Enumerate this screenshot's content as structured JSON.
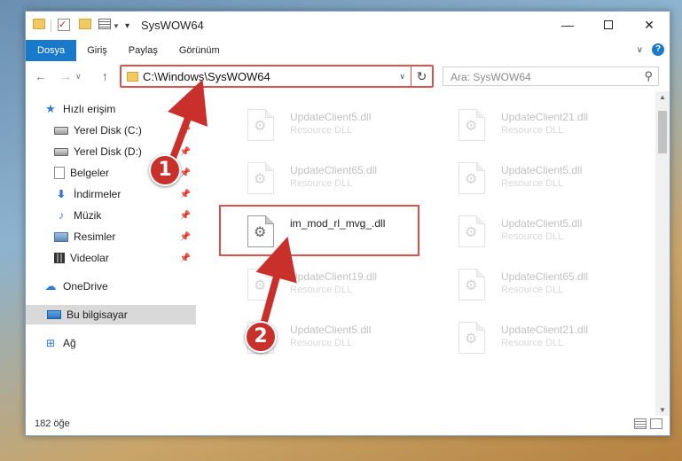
{
  "window": {
    "title": "SysWOW64"
  },
  "ribbon": {
    "tabs": [
      "Dosya",
      "Giriş",
      "Paylaş",
      "Görünüm"
    ],
    "help": "?"
  },
  "address": {
    "path": "C:\\Windows\\SysWOW64"
  },
  "search": {
    "placeholder": "Ara: SysWOW64"
  },
  "sidebar": {
    "items": [
      {
        "label": "Hızlı erişim",
        "icon": "star-icon"
      },
      {
        "label": "Yerel Disk (C:)",
        "icon": "drive-icon",
        "pinned": true
      },
      {
        "label": "Yerel Disk (D:)",
        "icon": "drive-icon",
        "pinned": true
      },
      {
        "label": "Belgeler",
        "icon": "documents-icon",
        "pinned": true
      },
      {
        "label": "İndirmeler",
        "icon": "download-icon",
        "pinned": true
      },
      {
        "label": "Müzik",
        "icon": "music-icon",
        "pinned": true
      },
      {
        "label": "Resimler",
        "icon": "pictures-icon",
        "pinned": true
      },
      {
        "label": "Videolar",
        "icon": "videos-icon",
        "pinned": true
      },
      {
        "label": "OneDrive",
        "icon": "cloud-icon"
      },
      {
        "label": "Bu bilgisayar",
        "icon": "computer-icon",
        "selected": true
      },
      {
        "label": "Ağ",
        "icon": "network-icon"
      }
    ]
  },
  "files": [
    {
      "name": "UpdateClient5.dll",
      "type": "Resource DLL"
    },
    {
      "name": "UpdateClient21.dll",
      "type": "Resource DLL"
    },
    {
      "name": "UpdateClient65.dll",
      "type": "Resource DLL"
    },
    {
      "name": "UpdateClient5.dll",
      "type": "Resource DLL"
    },
    {
      "name": "im_mod_rl_mvg_.dll",
      "type": ""
    },
    {
      "name": "UpdateClient5.dll",
      "type": "Resource DLL"
    },
    {
      "name": "UpdateClient19.dll",
      "type": "Resource DLL"
    },
    {
      "name": "UpdateClient65.dll",
      "type": "Resource DLL"
    },
    {
      "name": "UpdateClient5.dll",
      "type": "Resource DLL"
    },
    {
      "name": "UpdateClient21.dll",
      "type": "Resource DLL"
    }
  ],
  "status": {
    "count": "182 öğe"
  },
  "callouts": [
    "1",
    "2"
  ],
  "colors": {
    "accent": "#1979ca",
    "highlight": "#d9534f"
  }
}
